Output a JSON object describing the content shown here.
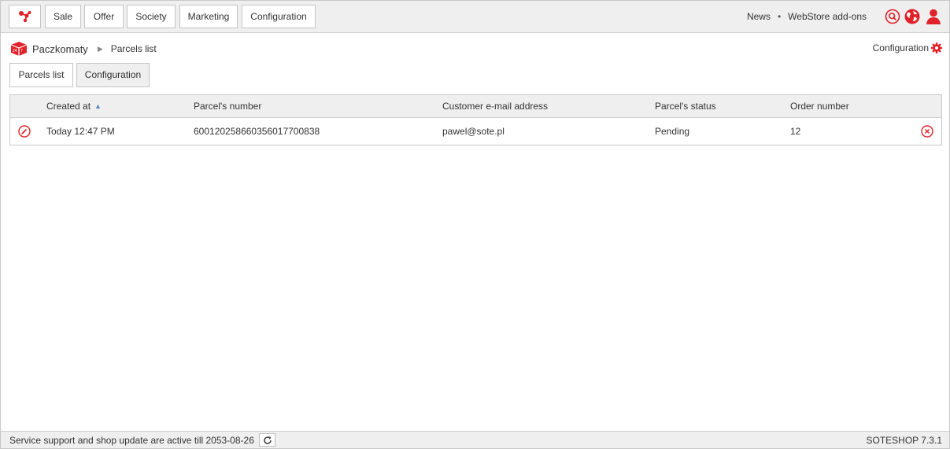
{
  "topnav": {
    "items": [
      "Sale",
      "Offer",
      "Society",
      "Marketing",
      "Configuration"
    ],
    "links": [
      "News",
      "WebStore add-ons"
    ],
    "separator": "•"
  },
  "breadcrumb": {
    "module": "Paczkomaty",
    "separator": "▶",
    "current": "Parcels list"
  },
  "config_link": "Configuration",
  "tabs": [
    "Parcels list",
    "Configuration"
  ],
  "table": {
    "columns": [
      "Created at",
      "Parcel's number",
      "Customer e-mail address",
      "Parcel's status",
      "Order number"
    ],
    "sort_indicator": "▲",
    "rows": [
      {
        "created_at": "Today 12:47 PM",
        "parcel_number": "600120258660356017700838",
        "email": "pawel@sote.pl",
        "status": "Pending",
        "order_number": "12"
      }
    ]
  },
  "footer": {
    "support_text": "Service support and shop update are active till 2053-08-26",
    "version": "SOTESHOP 7.3.1"
  },
  "colors": {
    "accent": "#e0222a",
    "sort_arrow": "#5c85c4"
  }
}
